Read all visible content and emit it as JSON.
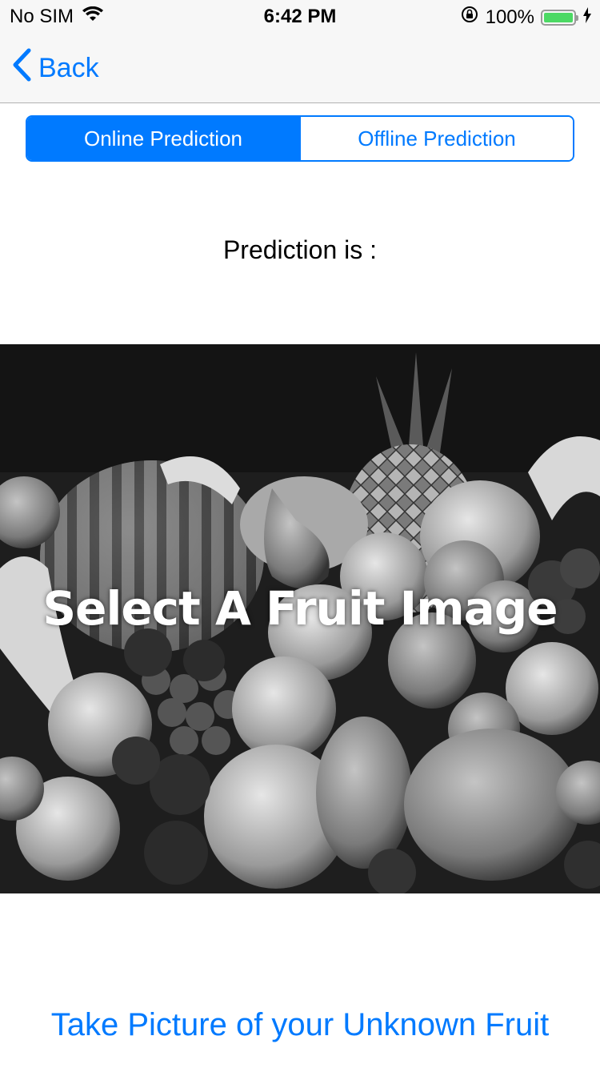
{
  "status_bar": {
    "carrier": "No SIM",
    "time": "6:42 PM",
    "battery_percent": "100%",
    "battery_level": 1.0,
    "battery_color": "#4cd964",
    "icons": [
      "wifi-icon",
      "orientation-lock-icon",
      "battery-icon",
      "charging-bolt-icon"
    ]
  },
  "nav": {
    "back_label": "Back",
    "accent_color": "#007aff"
  },
  "segmented_control": {
    "segments": [
      {
        "label": "Online Prediction",
        "selected": true
      },
      {
        "label": "Offline Prediction",
        "selected": false
      }
    ]
  },
  "prediction": {
    "label": "Prediction is :"
  },
  "image": {
    "overlay_text": "Select A Fruit Image",
    "description_icon": "fruit-photo"
  },
  "actions": {
    "take_picture_label": "Take Picture of your Unknown Fruit"
  }
}
